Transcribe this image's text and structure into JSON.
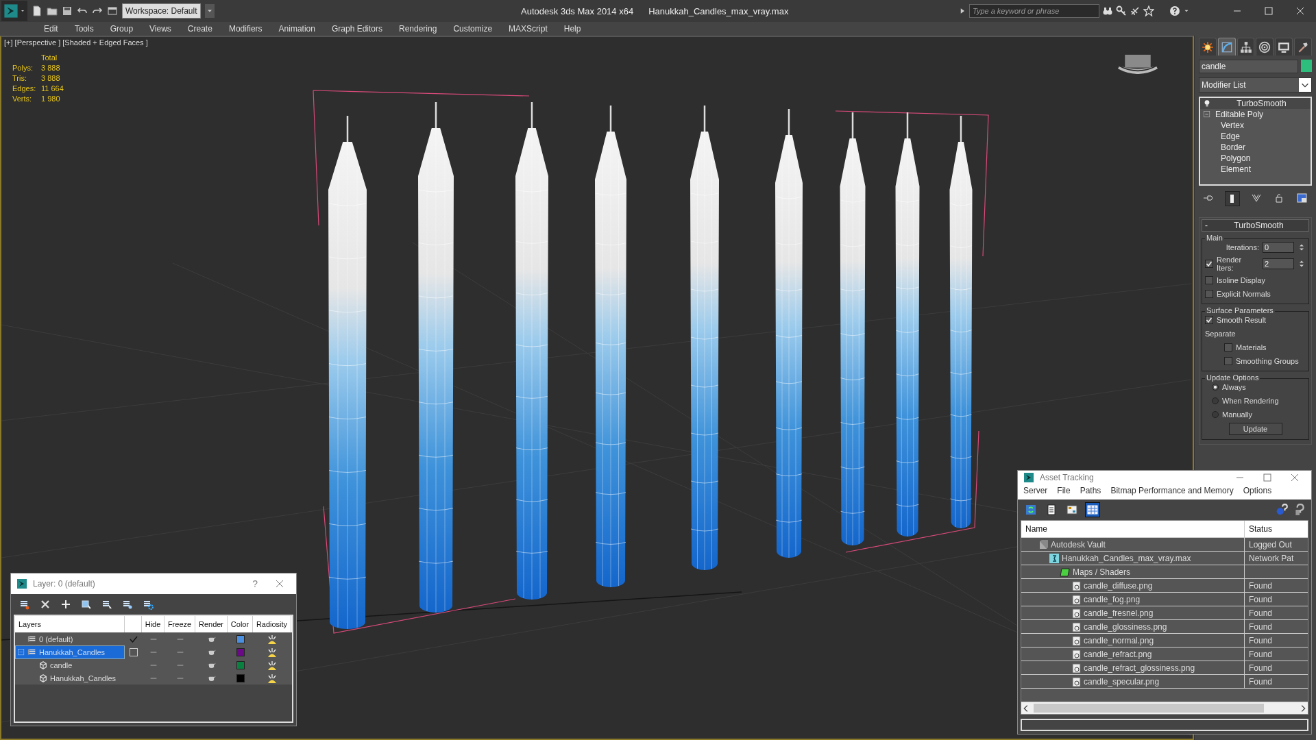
{
  "title_bar": {
    "workspace": "Workspace: Default",
    "app_title": "Autodesk 3ds Max  2014 x64",
    "file_title": "Hanukkah_Candles_max_vray.max",
    "search_placeholder": "Type a keyword or phrase"
  },
  "menu": [
    "Edit",
    "Tools",
    "Group",
    "Views",
    "Create",
    "Modifiers",
    "Animation",
    "Graph Editors",
    "Rendering",
    "Customize",
    "MAXScript",
    "Help"
  ],
  "viewport": {
    "label": "[+] [Perspective ] [Shaded + Edged Faces ]",
    "stats_header": "Total",
    "stats": [
      {
        "label": "Polys:",
        "value": "3 888"
      },
      {
        "label": "Tris:",
        "value": "3 888"
      },
      {
        "label": "Edges:",
        "value": "11 664"
      },
      {
        "label": "Verts:",
        "value": "1 980"
      }
    ]
  },
  "command_panel": {
    "tabs": [
      {
        "kind": "create",
        "selected": false
      },
      {
        "kind": "modify",
        "selected": true
      },
      {
        "kind": "hierarchy",
        "selected": false
      },
      {
        "kind": "motion",
        "selected": false
      },
      {
        "kind": "display",
        "selected": false
      },
      {
        "kind": "utilities",
        "selected": false
      }
    ],
    "object_name": "candle",
    "modifier_list": "Modifier List",
    "stack": [
      {
        "label": "TurboSmooth",
        "kind": "modifier"
      },
      {
        "label": "Editable Poly",
        "kind": "base",
        "expanded": true,
        "children": [
          {
            "label": "Vertex"
          },
          {
            "label": "Edge"
          },
          {
            "label": "Border"
          },
          {
            "label": "Polygon"
          },
          {
            "label": "Element"
          }
        ]
      }
    ],
    "rollout": {
      "toggle": "-",
      "title": "TurboSmooth",
      "groups": [
        {
          "title": "Main",
          "controls": [
            {
              "kind": "spinner",
              "label": "Iterations:",
              "value": "0"
            },
            {
              "kind": "check_spinner",
              "label": "Render Iters:",
              "value": "2",
              "checked": true
            },
            {
              "kind": "checkbox",
              "label": "Isoline Display",
              "checked": false
            },
            {
              "kind": "checkbox",
              "label": "Explicit Normals",
              "checked": false
            }
          ]
        },
        {
          "title": "Surface Parameters",
          "controls": [
            {
              "kind": "checkbox",
              "label": "Smooth Result",
              "checked": true
            },
            {
              "kind": "text",
              "label": "Separate"
            },
            {
              "kind": "sub_checkbox",
              "label": "Materials",
              "checked": false
            },
            {
              "kind": "sub_checkbox",
              "label": "Smoothing Groups",
              "checked": false
            }
          ]
        },
        {
          "title": "Update Options",
          "controls": [
            {
              "kind": "radio",
              "label": "Always",
              "selected": true
            },
            {
              "kind": "radio",
              "label": "When Rendering",
              "selected": false
            },
            {
              "kind": "radio",
              "label": "Manually",
              "selected": false
            },
            {
              "kind": "button",
              "label": "Update"
            }
          ]
        }
      ]
    }
  },
  "layer_dialog": {
    "title": "Layer: 0 (default)",
    "help": "?",
    "columns": [
      "Layers",
      "Hide",
      "Freeze",
      "Render",
      "Color",
      "Radiosity"
    ],
    "rows": [
      {
        "name": "0 (default)",
        "kind": "layer",
        "current": true,
        "selected": false,
        "color": "#4a8fe0"
      },
      {
        "name": "Hanukkah_Candles",
        "kind": "layer",
        "current": false,
        "selected": true,
        "expanded": true,
        "color": "#6a0a86",
        "children": [
          {
            "name": "candle",
            "kind": "object",
            "selected": false,
            "color": "#0a8040"
          },
          {
            "name": "Hanukkah_Candles",
            "kind": "object",
            "selected": false,
            "color": "#000000"
          }
        ]
      }
    ]
  },
  "asset_tracking": {
    "title": "Asset Tracking",
    "menu": [
      "Server",
      "File",
      "Paths",
      "Bitmap Performance and Memory",
      "Options"
    ],
    "tools": [
      {
        "kind": "refresh",
        "selected": false
      },
      {
        "kind": "list",
        "selected": false
      },
      {
        "kind": "thumbnails",
        "selected": false
      },
      {
        "kind": "table",
        "selected": true
      }
    ],
    "columns": [
      "Name",
      "Status"
    ],
    "rows": [
      {
        "name": "Autodesk Vault",
        "kind": "vault",
        "status": "Logged Out",
        "children": [
          {
            "name": "Hanukkah_Candles_max_vray.max",
            "kind": "scene",
            "status": "Network Pat",
            "children": [
              {
                "name": "Maps / Shaders",
                "kind": "folder",
                "children": [
                  {
                    "name": "candle_diffuse.png",
                    "kind": "bitmap",
                    "status": "Found"
                  },
                  {
                    "name": "candle_fog.png",
                    "kind": "bitmap",
                    "status": "Found"
                  },
                  {
                    "name": "candle_fresnel.png",
                    "kind": "bitmap",
                    "status": "Found"
                  },
                  {
                    "name": "candle_glossiness.png",
                    "kind": "bitmap",
                    "status": "Found"
                  },
                  {
                    "name": "candle_normal.png",
                    "kind": "bitmap",
                    "status": "Found"
                  },
                  {
                    "name": "candle_refract.png",
                    "kind": "bitmap",
                    "status": "Found"
                  },
                  {
                    "name": "candle_refract_glossiness.png",
                    "kind": "bitmap",
                    "status": "Found"
                  },
                  {
                    "name": "candle_specular.png",
                    "kind": "bitmap",
                    "status": "Found"
                  }
                ]
              }
            ]
          }
        ]
      }
    ]
  }
}
